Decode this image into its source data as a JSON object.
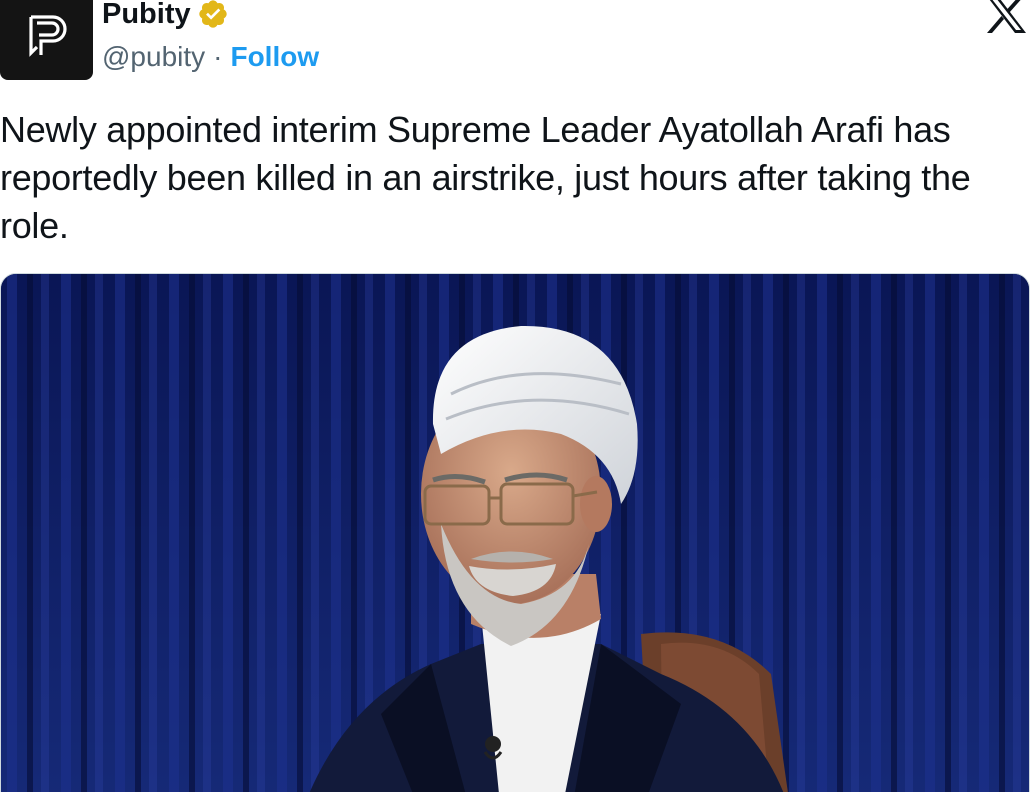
{
  "header": {
    "display_name": "Pubity",
    "handle": "@pubity",
    "separator": "·",
    "follow_label": "Follow"
  },
  "tweet": {
    "text": "Newly appointed interim Supreme Leader Ayatollah Arafi has reportedly been killed in an airstrike, just hours after taking the role."
  },
  "icons": {
    "avatar": "pubity-logo-icon",
    "verified": "verified-badge-icon",
    "brand": "x-logo-icon"
  },
  "colors": {
    "link": "#1d9bf0",
    "verified_badge": "#e2b719",
    "text": "#0f1419",
    "muted": "#536471"
  }
}
